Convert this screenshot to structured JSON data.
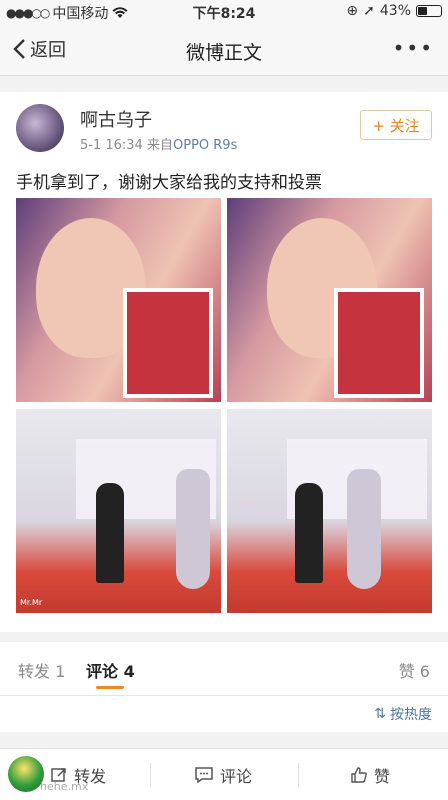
{
  "status": {
    "carrier": "中国移动",
    "time": "下午8:24",
    "battery": "43%",
    "battery_level": 0.43
  },
  "nav": {
    "back": "返回",
    "title": "微博正文",
    "more": "•••"
  },
  "post": {
    "username": "啊古乌子",
    "time": "5-1 16:34",
    "source_prefix": "来自",
    "device": "OPPO R9s",
    "follow": "+ 关注",
    "text": "手机拿到了，谢谢大家给我的支持和投票",
    "photo_caption": "Mr.Mr"
  },
  "tabs": {
    "repost": "转发 1",
    "comment": "评论 4",
    "like": "赞 6"
  },
  "sort": {
    "label": "按热度"
  },
  "bottom": {
    "repost": "转发",
    "comment": "评论",
    "like": "赞"
  },
  "watermark": "hehe.mx"
}
